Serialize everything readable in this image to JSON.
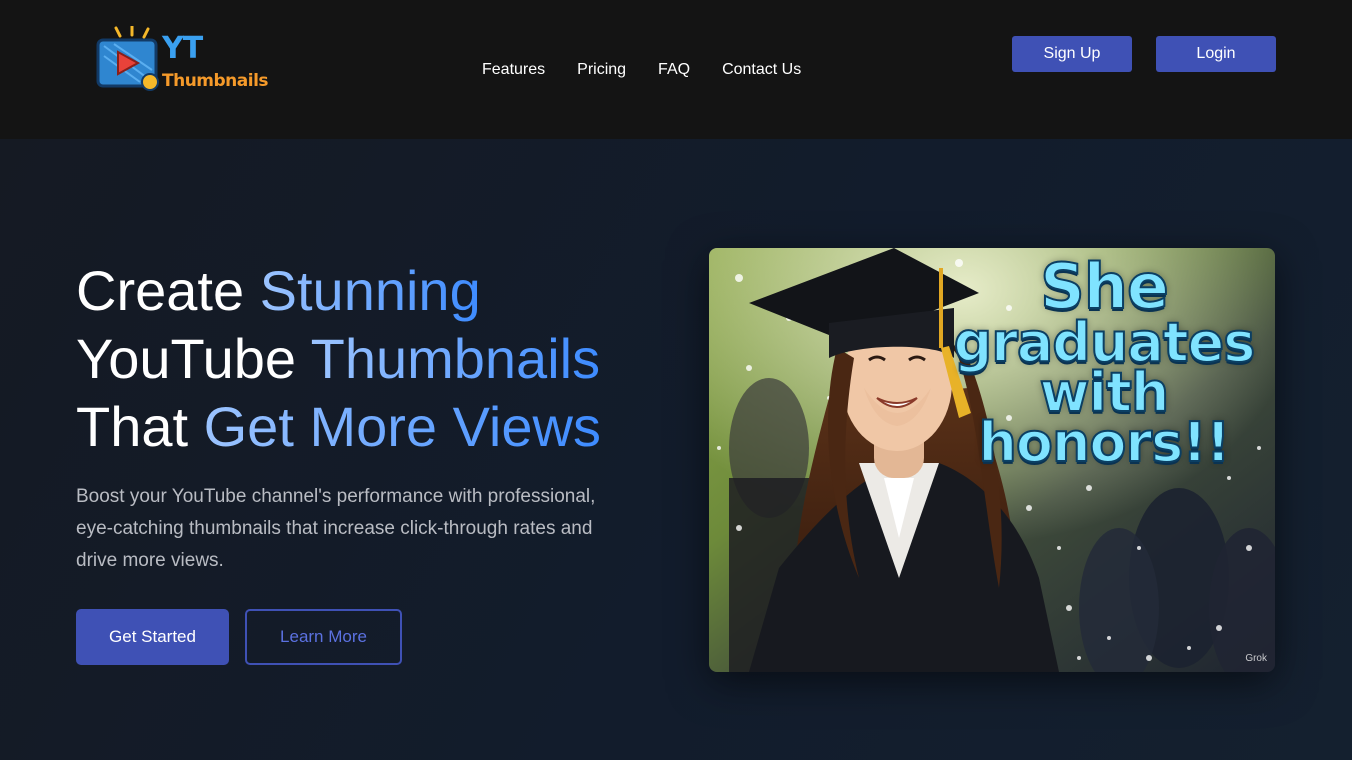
{
  "brand": {
    "line1": "YT",
    "line2": "Thumbnails",
    "colors": {
      "primary_blue": "#3aa0f0",
      "orange": "#f59a2a"
    }
  },
  "nav": {
    "items": [
      {
        "label": "Features"
      },
      {
        "label": "Pricing"
      },
      {
        "label": "FAQ"
      },
      {
        "label": "Contact Us"
      }
    ]
  },
  "auth": {
    "signup_label": "Sign Up",
    "login_label": "Login"
  },
  "hero": {
    "title_lines": [
      {
        "plain": "Create ",
        "highlight": "Stunning"
      },
      {
        "plain": "YouTube ",
        "highlight": "Thumbnails"
      },
      {
        "plain": "That ",
        "highlight": "Get More Views"
      }
    ],
    "subtitle": "Boost your YouTube channel's performance with professional, eye-catching thumbnails that increase click-through rates and drive more views.",
    "cta_primary": "Get Started",
    "cta_secondary": "Learn More"
  },
  "thumbnail": {
    "text_line1": "She",
    "text_line2": "graduates",
    "text_line3": "with",
    "text_line4": "honors!!",
    "watermark": "Grok"
  },
  "theme": {
    "accent": "#3f51b5",
    "text_muted": "#b9bcc3",
    "header_bg": "#141414",
    "hero_bg": "#121c2c"
  }
}
